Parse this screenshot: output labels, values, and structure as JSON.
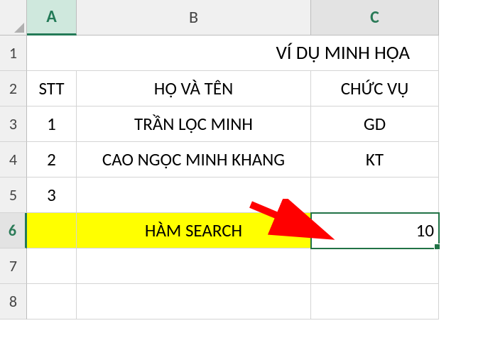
{
  "columns": {
    "A": "A",
    "B": "B",
    "C": "C"
  },
  "row_labels": [
    "1",
    "2",
    "3",
    "4",
    "5",
    "6",
    "7",
    "8"
  ],
  "title": "VÍ DỤ MINH HỌA",
  "headers": {
    "stt": "STT",
    "name": "HỌ VÀ TÊN",
    "role": "CHỨC VỤ"
  },
  "rows": [
    {
      "stt": "1",
      "name": "TRẦN LỘC MINH",
      "role": "GD"
    },
    {
      "stt": "2",
      "name": "CAO NGỌC MINH KHANG",
      "role": "KT"
    },
    {
      "stt": "3",
      "name": "",
      "role": ""
    }
  ],
  "search_row": {
    "label": "HÀM SEARCH",
    "result": "10"
  },
  "active_cell": "C6"
}
